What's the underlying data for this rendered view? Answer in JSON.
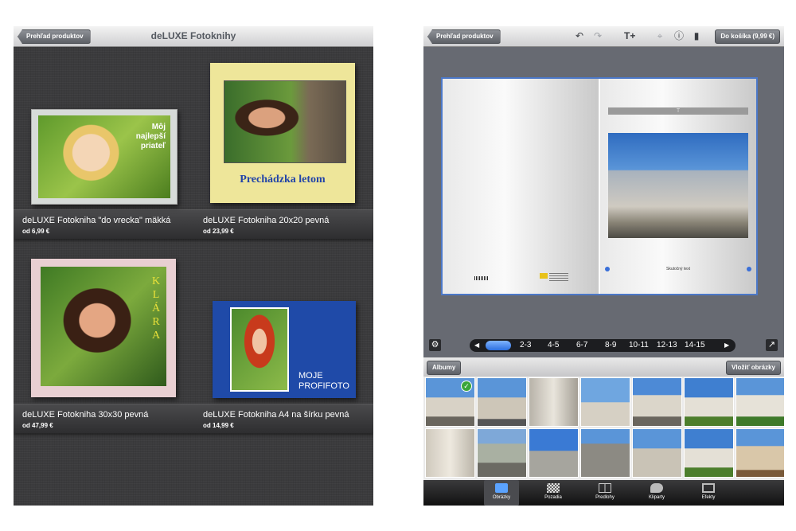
{
  "left_screen": {
    "back_label": "Prehľad produktov",
    "title": "deLUXE Fotoknihy",
    "products": [
      {
        "name": "deLUXE Fotokniha \"do vrecka\" mäkká",
        "price": "od 6,99 €",
        "cover_text": "Môj\nnajlepší\npriateľ"
      },
      {
        "name": "deLUXE Fotokniha 20x20 pevná",
        "price": "od 23,99 €",
        "cover_text": "Prechádzka letom"
      },
      {
        "name": "deLUXE Fotokniha 30x30 pevná",
        "price": "od 47,99 €",
        "cover_text": "KLÁRA"
      },
      {
        "name": "deLUXE Fotokniha A4 na šírku pevná",
        "price": "od 14,99 €",
        "cover_text": "MOJE\nPROFIFOTO"
      }
    ]
  },
  "right_screen": {
    "back_label": "Prehľad produktov",
    "cart_label": "Do košíka (9,99 €)",
    "toolbar_icons": [
      "undo-icon",
      "redo-icon",
      "add-text-icon",
      "crop-icon",
      "info-icon",
      "trash-icon"
    ],
    "page_caption": "Skutočný text",
    "page_header": "T",
    "pages": [
      "2-3",
      "4-5",
      "6-7",
      "8-9",
      "10-11",
      "12-13",
      "14-15"
    ],
    "albums_label": "Albumy",
    "insert_label": "Vložiť obrázky",
    "tabs": [
      {
        "label": "Obrázky",
        "icon": "camera-icon"
      },
      {
        "label": "Pozadia",
        "icon": "pattern-icon"
      },
      {
        "label": "Predlohy",
        "icon": "layout-icon"
      },
      {
        "label": "Kliparty",
        "icon": "speech-bubble-icon"
      },
      {
        "label": "Efekty",
        "icon": "frame-icon"
      }
    ]
  }
}
